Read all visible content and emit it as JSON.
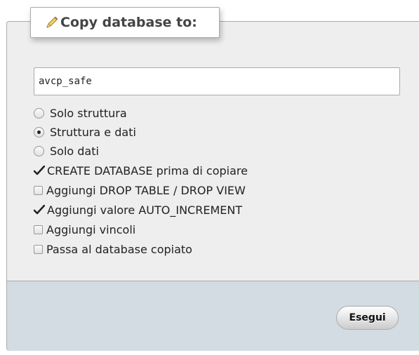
{
  "legend": {
    "title": "Copy database to:",
    "icon": "pencil-icon"
  },
  "database_input": {
    "value": "avcp_safe"
  },
  "structure_options": [
    {
      "label": "Solo struttura",
      "checked": false
    },
    {
      "label": "Struttura e dati",
      "checked": true
    },
    {
      "label": "Solo dati",
      "checked": false
    }
  ],
  "checkboxes": [
    {
      "label": "CREATE DATABASE prima di copiare",
      "checked": true
    },
    {
      "label": "Aggiungi DROP TABLE / DROP VIEW",
      "checked": false
    },
    {
      "label": "Aggiungi valore AUTO_INCREMENT",
      "checked": true
    },
    {
      "label": "Aggiungi vincoli",
      "checked": false
    },
    {
      "label": "Passa al database copiato",
      "checked": false
    }
  ],
  "submit_button": {
    "label": "Esegui"
  },
  "colors": {
    "panel": "#eeeeee",
    "footer": "#d3dce3",
    "border": "#aaaaaa"
  }
}
